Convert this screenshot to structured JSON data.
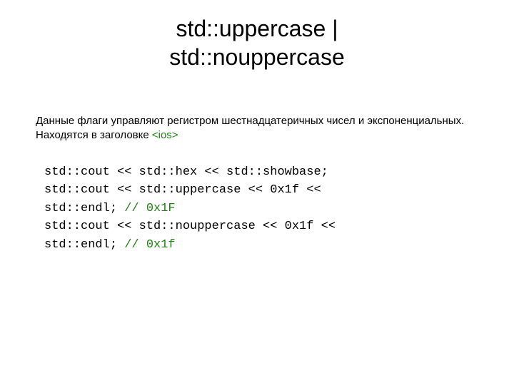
{
  "title_line1": "std::uppercase |",
  "title_line2": "std::nouppercase",
  "description": {
    "line1": "Данные флаги управляют регистром шестнадцатеричных чисел и экспоненциальных.",
    "line2_prefix": "Находятся в заголовке ",
    "header_name": "<ios>"
  },
  "code": {
    "l1": "std::cout << std::hex << std::showbase;",
    "l2": "std::cout << std::uppercase << 0x1f <<",
    "l3": "std::endl; ",
    "l3_comment": "// 0x1F",
    "l4": "std::cout << std::nouppercase << 0x1f <<",
    "l5": "std::endl; ",
    "l5_comment": "// 0x1f"
  }
}
